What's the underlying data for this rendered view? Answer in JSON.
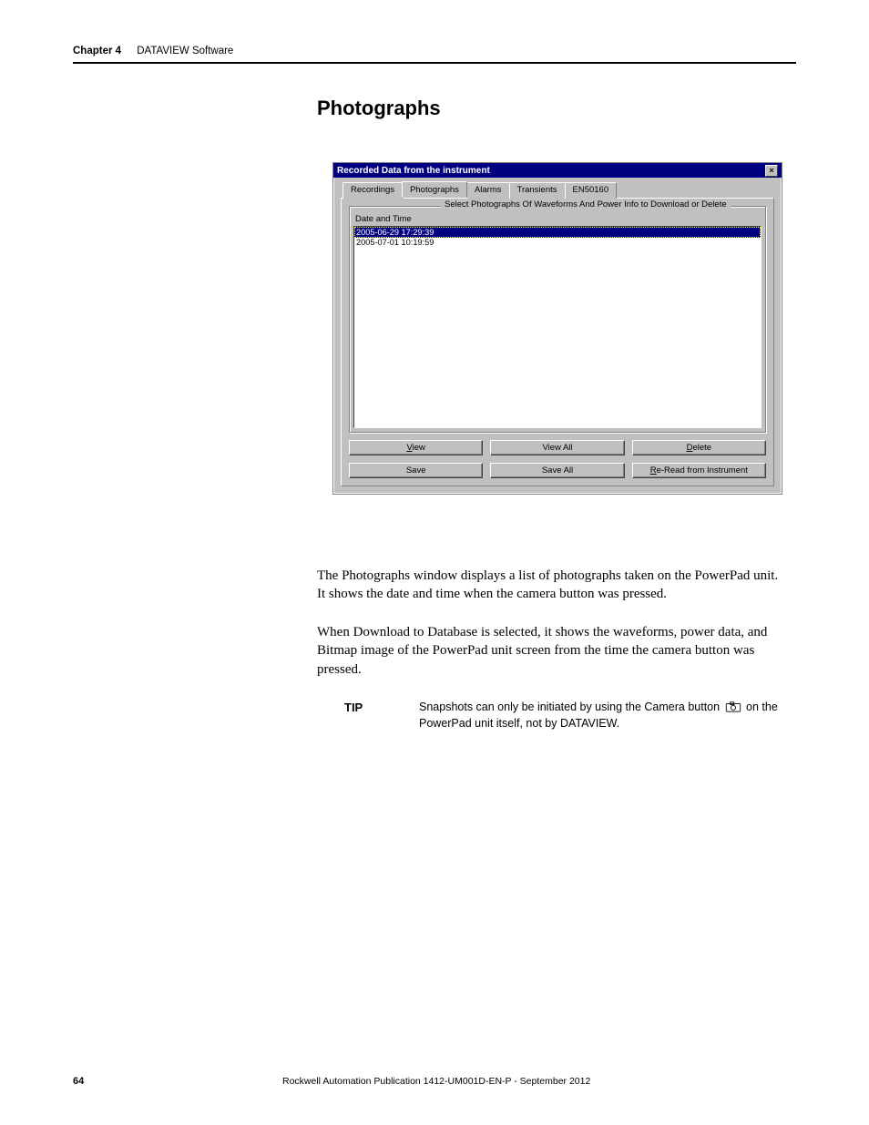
{
  "header": {
    "chapter": "Chapter 4",
    "software": "DATAVIEW Software"
  },
  "heading": "Photographs",
  "dialog": {
    "title": "Recorded Data from the instrument",
    "close_glyph": "×",
    "tabs": {
      "recordings": "Recordings",
      "photographs": "Photographs",
      "alarms": "Alarms",
      "transients": "Transients",
      "en50160": "EN50160"
    },
    "fieldset_legend": "Select Photographs Of Waveforms And Power Info to Download or Delete",
    "list_label": "Date and Time",
    "items": [
      "2005-06-29 17:29:39",
      "2005-07-01 10:19:59"
    ],
    "buttons": {
      "view_u": "V",
      "view_rest": "iew",
      "view_all": "View All",
      "delete_u": "D",
      "delete_rest": "elete",
      "save": "Save",
      "save_all": "Save All",
      "reread_u": "R",
      "reread_rest": "e-Read from Instrument"
    }
  },
  "body": {
    "p1": "The Photographs window displays a list of photographs taken on the PowerPad unit. It shows the date and time when the camera button was pressed.",
    "p2": "When Download to Database is selected, it shows the waveforms, power data, and Bitmap image of the PowerPad unit screen from the time the camera button was pressed."
  },
  "tip": {
    "label": "TIP",
    "text_before": "Snapshots can only be initiated by using the Camera button ",
    "text_after": " on the PowerPad unit itself, not by DATAVIEW."
  },
  "footer": {
    "page": "64",
    "publication": "Rockwell Automation Publication 1412-UM001D-EN-P - September 2012"
  }
}
